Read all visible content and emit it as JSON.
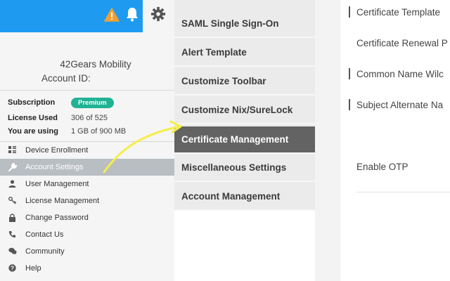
{
  "account": {
    "name": "42Gears Mobility",
    "account_id_label": "Account ID:",
    "subscription_label": "Subscription",
    "subscription_badge": "Premium",
    "license_used_label": "License Used",
    "license_used_value": "306 of 525",
    "storage_label": "You are using",
    "storage_value": "1 GB of 900 MB"
  },
  "left_menu": {
    "items": [
      {
        "label": "Device Enrollment",
        "icon": "device-enrollment-icon"
      },
      {
        "label": "Account Settings",
        "icon": "wrench-icon"
      },
      {
        "label": "User Management",
        "icon": "user-icon"
      },
      {
        "label": "License Management",
        "icon": "key-icon"
      },
      {
        "label": "Change Password",
        "icon": "lock-icon"
      },
      {
        "label": "Contact Us",
        "icon": "phone-icon"
      },
      {
        "label": "Community",
        "icon": "chat-icon"
      },
      {
        "label": "Help",
        "icon": "help-icon"
      }
    ],
    "active_index": 1
  },
  "settings_menu": {
    "items": [
      "SAML Single Sign-On",
      "Alert Template",
      "Customize Toolbar",
      "Customize Nix/SureLock",
      "Certificate Management",
      "Miscellaneous Settings",
      "Account Management"
    ],
    "active_index": 4
  },
  "detail_panel": {
    "labels": [
      "Certificate Template",
      "Certificate Renewal P",
      "Common Name Wilc",
      "Subject Alternate Na",
      "Enable OTP"
    ]
  },
  "colors": {
    "topbar": "#1e9bf0",
    "premium_badge": "#1fb394",
    "active_settings_item": "#636363",
    "active_left_item": "#b9bec3",
    "warning": "#f0a030",
    "highlighter_arrow": "#f4ee4a"
  }
}
